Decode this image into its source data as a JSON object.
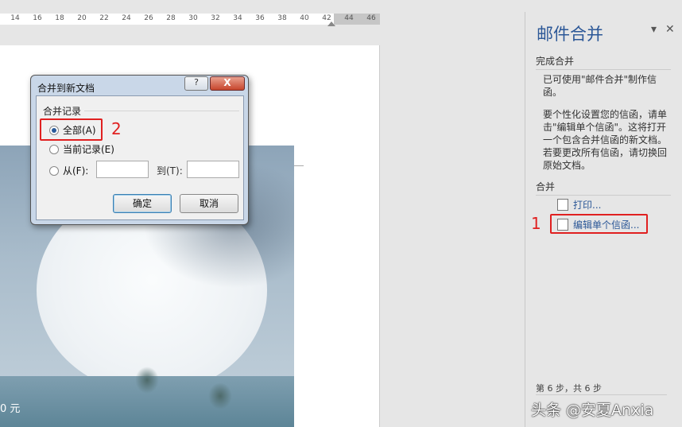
{
  "ruler": {
    "ticks": [
      "14",
      "16",
      "18",
      "20",
      "22",
      "24",
      "26",
      "28",
      "30",
      "32",
      "34",
      "36",
      "38",
      "40",
      "42",
      "44",
      "46"
    ]
  },
  "document": {
    "price_text": "0 元"
  },
  "dialog": {
    "title": "合并到新文档",
    "help": "?",
    "close": "X",
    "group_label": "合并记录",
    "options": [
      {
        "label": "全部(A)",
        "selected": true
      },
      {
        "label": "当前记录(E)",
        "selected": false
      },
      {
        "label": "从(F):",
        "selected": false
      }
    ],
    "to_label": "到(T):",
    "from_value": "",
    "to_value": "",
    "ok": "确定",
    "cancel": "取消"
  },
  "pane": {
    "title": "邮件合并",
    "dropdown": "▾",
    "close": "✕",
    "section1": "完成合并",
    "text1": "已可使用\"邮件合并\"制作信函。",
    "text2": "要个性化设置您的信函，请单击\"编辑单个信函\"。这将打开一个包含合并信函的新文档。若要更改所有信函，请切换回原始文档。",
    "section2": "合并",
    "print_link": "打印...",
    "edit_link": "编辑单个信函...",
    "step": "第 6 步，共 6 步"
  },
  "annotations": {
    "one": "1",
    "two": "2"
  },
  "watermark": "头条 @安夏Anxia"
}
